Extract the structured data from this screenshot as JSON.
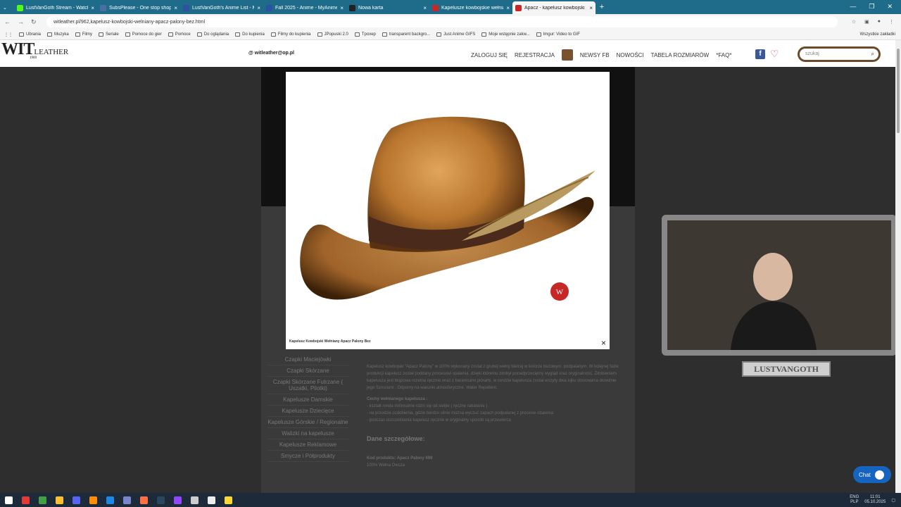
{
  "browser": {
    "tabs": [
      {
        "title": "LustVanGoth Stream - Watch L",
        "color": "#53fc18",
        "active": false
      },
      {
        "title": "SubsPlease - One stop shop fo",
        "color": "#4a6fa5",
        "active": false
      },
      {
        "title": "LustVanGoth's Anime List - My",
        "color": "#2e51a2",
        "active": false
      },
      {
        "title": "Fall 2025 - Anime - MyAnimeLi",
        "color": "#2e51a2",
        "active": false
      },
      {
        "title": "Nowa karta",
        "color": "#222222",
        "active": false
      },
      {
        "title": "Kapelusze kowbojskie wełnian",
        "color": "#c62828",
        "active": false
      },
      {
        "title": "Apacz - kapelusz kowbojski pa",
        "color": "#c62828",
        "active": true
      }
    ],
    "new_tab": "+",
    "close": "×",
    "url": "witleather.pl/962,kapelusz-kowbojski-welniany-apacz-palony-bez.html",
    "bookmarks": [
      "Ubrania",
      "Muzyka",
      "Filmy",
      "Seriale",
      "Pomoce do gier",
      "Pomoce",
      "Do oglądania",
      "Do kupienia",
      "Filmy do kupienia",
      "JPopuski 2.0",
      "Tpoxep",
      "transparent backgro...",
      "Just Anime GIFS",
      "Moje wstępnie zakw...",
      "Imgur: Video to GIF"
    ],
    "bookmarks_right": "Wszystkie zakładki"
  },
  "site": {
    "logo_main": "WIT",
    "logo_sub": "LEATHER",
    "logo_year": "1969",
    "email": "witleather@op.pl",
    "nav": [
      "ZALOGUJ SIĘ",
      "REJESTRACJA",
      "NEWSY FB",
      "NOWOŚCI",
      "TABELA ROZMIARÓW",
      "*FAQ*"
    ],
    "search_placeholder": "szukaj",
    "side_menu": [
      "Czapki Maciejówki",
      "Czapki Skórzane",
      "Czapki Skórzane Futrzane ( Uszatki, Pilotki)",
      "Kapelusze Damskie",
      "Kapelusze Dziecięce",
      "Kapelusze Górskie / Regionalne",
      "Walizki na kapelusze",
      "Kapelusze Reklamowe",
      "Smycze i Półprodukty"
    ],
    "description": "Kapelusz kowbojski \"Apacz Palony\" w 100% wykonany został z grubej wełny bielcej w kolorze beżowym. podpalanym. W kolejnej fazie produkcji kapelusz został poddany procesowi opalenia, dzięki któremu zdobył ponadprzeciętny wygląd oraz oryginalność. Zdobieniem kapelusza jest brązowa rozetna ręcznie wraz z baranicami piórami, w rondzie kapelusza został wszyty dwa kijku stosowania dowolnie jego Sznurami . Odporny na warunki atmosferyczne. Water Repellent.",
    "features_title": "Cechy wełnianego kapelusza :",
    "features": [
      "- kształt ronda minimalnie różni się od siebie ( ręczne rabatanie )",
      "- na przodzie ozdobienia, gdzie bardzo silnie można wyczuć zapach podpalanej z procesie obalenia",
      "- podczas uszczelniania kapelusz ręcznie w oryginalny sposób są przewierca"
    ],
    "details_title": "Dane szczegółowe:",
    "product_code": "Kod produktu: Apacz Palony 699",
    "material": "100% Wełna Owcza"
  },
  "lightbox": {
    "caption": "Kapelusz Kowbojski Wełniany Apacz Palony Bez",
    "close": "×",
    "logo_text": "W"
  },
  "stream": {
    "label": "LUSTVANGOTH"
  },
  "chat": {
    "label": "Chat"
  },
  "taskbar": {
    "lang": "ENG",
    "lang2": "PLP",
    "time": "11:01",
    "date": "05.10.2025",
    "icons": [
      {
        "name": "windows-icon",
        "color": "#ffffff"
      },
      {
        "name": "chrome-icon",
        "color": "#e53935"
      },
      {
        "name": "app-icon",
        "color": "#43a047"
      },
      {
        "name": "app-icon",
        "color": "#fbc02d"
      },
      {
        "name": "discord-icon",
        "color": "#5865f2"
      },
      {
        "name": "vlc-icon",
        "color": "#ff8f00"
      },
      {
        "name": "app-icon",
        "color": "#1e88e5"
      },
      {
        "name": "app-icon",
        "color": "#7986cb"
      },
      {
        "name": "firefox-icon",
        "color": "#ff7043"
      },
      {
        "name": "steam-icon",
        "color": "#2a475e"
      },
      {
        "name": "twitch-icon",
        "color": "#9146ff"
      },
      {
        "name": "obs-icon",
        "color": "#cccccc"
      },
      {
        "name": "app-icon",
        "color": "#eeeeee"
      },
      {
        "name": "folder-icon",
        "color": "#fdd835"
      }
    ]
  }
}
